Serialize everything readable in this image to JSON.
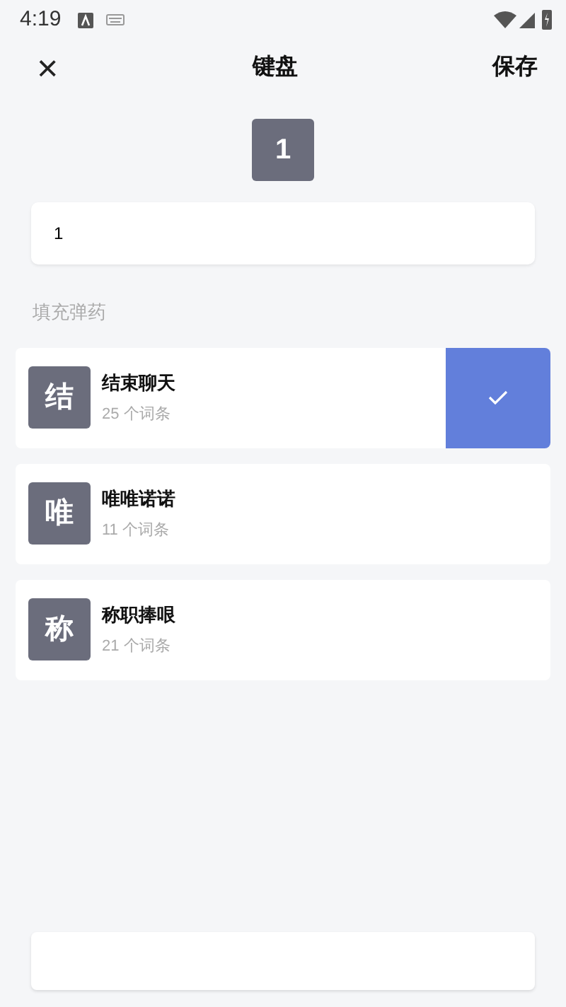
{
  "status_bar": {
    "time": "4:19"
  },
  "header": {
    "close": "×",
    "title": "键盘",
    "save": "保存"
  },
  "key_preview": "1",
  "key_input": {
    "value": "1"
  },
  "section_label": "填充弹药",
  "items": [
    {
      "initial": "结",
      "title": "结束聊天",
      "count": "25 个词条",
      "selected": true
    },
    {
      "initial": "唯",
      "title": "唯唯诺诺",
      "count": "11 个词条",
      "selected": false
    },
    {
      "initial": "称",
      "title": "称职捧哏",
      "count": "21 个词条",
      "selected": false
    }
  ]
}
